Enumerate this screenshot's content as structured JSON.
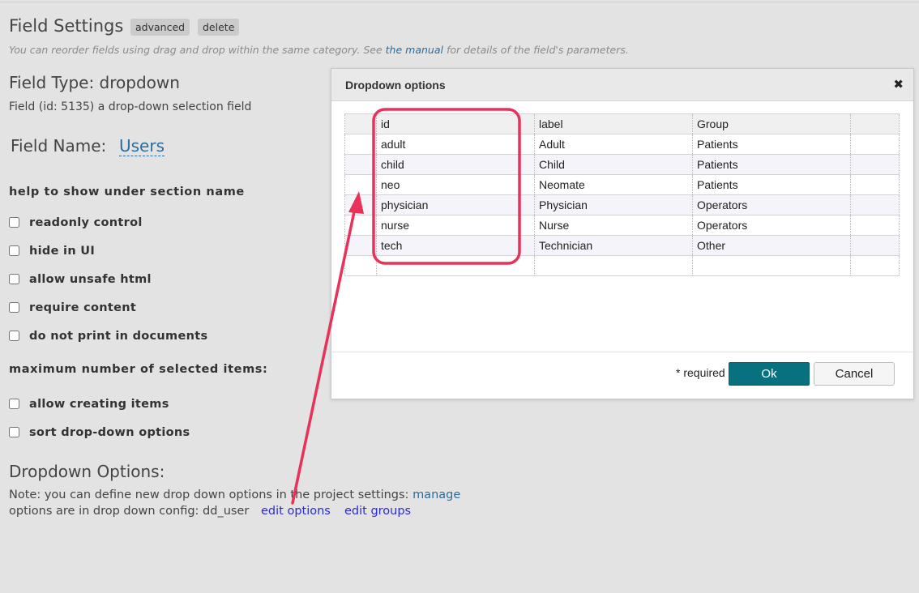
{
  "page": {
    "title": "Field Settings",
    "advanced_label": "advanced",
    "delete_label": "delete",
    "hint_prefix": "You can reorder fields using drag and drop within the same category. See ",
    "hint_link": "the manual",
    "hint_suffix": " for details of the field's parameters."
  },
  "field": {
    "type_heading": "Field Type: dropdown",
    "description": "Field (id: 5135) a drop-down selection field",
    "name_label": "Field Name:",
    "name_value": "Users"
  },
  "sections": {
    "help": "help to show under section name",
    "max_items": "maximum number of selected items:"
  },
  "checkboxes": [
    {
      "label": "readonly control",
      "checked": false
    },
    {
      "label": "hide in UI",
      "checked": false
    },
    {
      "label": "allow unsafe html",
      "checked": false
    },
    {
      "label": "require content",
      "checked": false
    },
    {
      "label": "do not print in documents",
      "checked": false
    },
    {
      "label": "allow creating items",
      "checked": false
    },
    {
      "label": "sort drop-down options",
      "checked": false
    }
  ],
  "dropdown_options": {
    "heading": "Dropdown Options:",
    "note_text": "Note: you can define new drop down options in the project settings:",
    "manage_link": "manage",
    "config_text": "options are in drop down config: dd_user",
    "edit_options_link": "edit options",
    "edit_groups_link": "edit groups"
  },
  "dialog": {
    "title": "Dropdown options",
    "close_glyph": "✖",
    "columns": [
      "id",
      "label",
      "Group"
    ],
    "rows": [
      {
        "id": "adult",
        "label": "Adult",
        "group": "Patients"
      },
      {
        "id": "child",
        "label": "Child",
        "group": "Patients"
      },
      {
        "id": "neo",
        "label": "Neomate",
        "group": "Patients"
      },
      {
        "id": "physician",
        "label": "Physician",
        "group": "Operators"
      },
      {
        "id": "nurse",
        "label": "Nurse",
        "group": "Operators"
      },
      {
        "id": "tech",
        "label": "Technician",
        "group": "Other"
      }
    ],
    "required_note": "* required",
    "ok_label": "Ok",
    "cancel_label": "Cancel"
  },
  "annotation": {
    "color": "#e8325a"
  }
}
